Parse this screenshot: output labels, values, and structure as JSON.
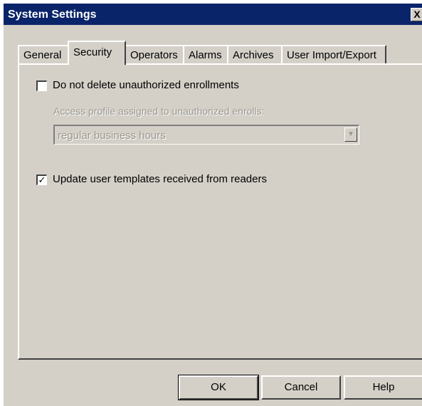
{
  "window": {
    "title": "System Settings",
    "close_label": "X"
  },
  "tabs": [
    "General",
    "Security",
    "Operators",
    "Alarms",
    "Archives",
    "User Import/Export"
  ],
  "active_tab": "Security",
  "security": {
    "do_not_delete": {
      "label": "Do not delete unauthorized enrollments",
      "checked": false
    },
    "access_profile_label": "Access profile assigned to unauthorized enrolls:",
    "access_profile_value": "regular business hours",
    "update_templates": {
      "label": "Update user templates received from readers",
      "checked": true
    }
  },
  "buttons": {
    "ok": "OK",
    "cancel": "Cancel",
    "help": "Help"
  },
  "glyphs": {
    "check": "✓",
    "dropdown": "▼"
  }
}
